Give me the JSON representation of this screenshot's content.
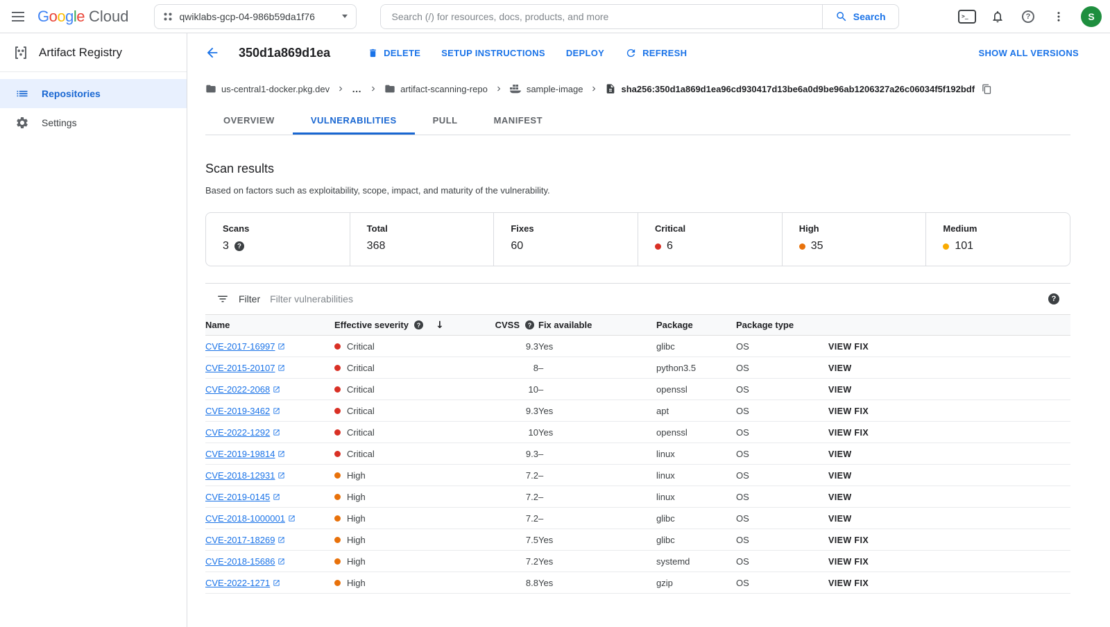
{
  "colors": {
    "accent_blue": "#1a73e8",
    "active_tab_blue": "#1967d2",
    "critical_red": "#d93025",
    "high_orange": "#e8710a",
    "medium_yellow": "#f9ab00",
    "avatar_green": "#1e8e3e",
    "selected_nav_bg": "#e8f0fe"
  },
  "topbar": {
    "logo_google_letters": [
      {
        "ch": "G",
        "color": "#4285F4"
      },
      {
        "ch": "o",
        "color": "#EA4335"
      },
      {
        "ch": "o",
        "color": "#FBBC04"
      },
      {
        "ch": "g",
        "color": "#4285F4"
      },
      {
        "ch": "l",
        "color": "#34A853"
      },
      {
        "ch": "e",
        "color": "#EA4335"
      }
    ],
    "logo_cloud": "Cloud",
    "project_name": "qwiklabs-gcp-04-986b59da1f76",
    "search_placeholder": "Search (/) for resources, docs, products, and more",
    "search_button": "Search",
    "avatar_letter": "S"
  },
  "sidebar": {
    "app_title": "Artifact Registry",
    "items": [
      {
        "label": "Repositories",
        "selected": true
      },
      {
        "label": "Settings",
        "selected": false
      }
    ]
  },
  "page_header": {
    "title": "350d1a869d1ea",
    "delete": "DELETE",
    "setup": "SETUP INSTRUCTIONS",
    "deploy": "DEPLOY",
    "refresh": "REFRESH",
    "show_all_versions": "SHOW ALL VERSIONS"
  },
  "breadcrumb": {
    "registry": "us-central1-docker.pkg.dev",
    "ellipsis": "…",
    "repo": "artifact-scanning-repo",
    "image": "sample-image",
    "digest": "sha256:350d1a869d1ea96cd930417d13be6a0d9be96ab1206327a26c06034f5f192bdf"
  },
  "tabs": [
    {
      "label": "OVERVIEW"
    },
    {
      "label": "VULNERABILITIES",
      "active": true
    },
    {
      "label": "PULL"
    },
    {
      "label": "MANIFEST"
    }
  ],
  "scan_results": {
    "title": "Scan results",
    "description": "Based on factors such as exploitability, scope, impact, and maturity of the vulnerability.",
    "stats": [
      {
        "label": "Scans",
        "value": "3"
      },
      {
        "label": "Total",
        "value": "368"
      },
      {
        "label": "Fixes",
        "value": "60"
      },
      {
        "label": "Critical",
        "value": "6",
        "dot": "#d93025"
      },
      {
        "label": "High",
        "value": "35",
        "dot": "#e8710a"
      },
      {
        "label": "Medium",
        "value": "101",
        "dot": "#f9ab00"
      }
    ]
  },
  "filter_bar": {
    "label": "Filter",
    "placeholder": "Filter vulnerabilities"
  },
  "table": {
    "headers": {
      "name": "Name",
      "severity": "Effective severity",
      "cvss": "CVSS",
      "fix": "Fix available",
      "package": "Package",
      "package_type": "Package type"
    },
    "rows": [
      {
        "name": "CVE-2017-16997",
        "severity": "Critical",
        "cvss": "9.3",
        "fix": "Yes",
        "package": "glibc",
        "package_type": "OS",
        "action": "VIEW FIX"
      },
      {
        "name": "CVE-2015-20107",
        "severity": "Critical",
        "cvss": "8",
        "fix": "–",
        "package": "python3.5",
        "package_type": "OS",
        "action": "VIEW"
      },
      {
        "name": "CVE-2022-2068",
        "severity": "Critical",
        "cvss": "10",
        "fix": "–",
        "package": "openssl",
        "package_type": "OS",
        "action": "VIEW"
      },
      {
        "name": "CVE-2019-3462",
        "severity": "Critical",
        "cvss": "9.3",
        "fix": "Yes",
        "package": "apt",
        "package_type": "OS",
        "action": "VIEW FIX"
      },
      {
        "name": "CVE-2022-1292",
        "severity": "Critical",
        "cvss": "10",
        "fix": "Yes",
        "package": "openssl",
        "package_type": "OS",
        "action": "VIEW FIX"
      },
      {
        "name": "CVE-2019-19814",
        "severity": "Critical",
        "cvss": "9.3",
        "fix": "–",
        "package": "linux",
        "package_type": "OS",
        "action": "VIEW"
      },
      {
        "name": "CVE-2018-12931",
        "severity": "High",
        "cvss": "7.2",
        "fix": "–",
        "package": "linux",
        "package_type": "OS",
        "action": "VIEW"
      },
      {
        "name": "CVE-2019-0145",
        "severity": "High",
        "cvss": "7.2",
        "fix": "–",
        "package": "linux",
        "package_type": "OS",
        "action": "VIEW"
      },
      {
        "name": "CVE-2018-1000001",
        "severity": "High",
        "cvss": "7.2",
        "fix": "–",
        "package": "glibc",
        "package_type": "OS",
        "action": "VIEW"
      },
      {
        "name": "CVE-2017-18269",
        "severity": "High",
        "cvss": "7.5",
        "fix": "Yes",
        "package": "glibc",
        "package_type": "OS",
        "action": "VIEW FIX"
      },
      {
        "name": "CVE-2018-15686",
        "severity": "High",
        "cvss": "7.2",
        "fix": "Yes",
        "package": "systemd",
        "package_type": "OS",
        "action": "VIEW FIX"
      },
      {
        "name": "CVE-2022-1271",
        "severity": "High",
        "cvss": "8.8",
        "fix": "Yes",
        "package": "gzip",
        "package_type": "OS",
        "action": "VIEW FIX"
      }
    ]
  }
}
